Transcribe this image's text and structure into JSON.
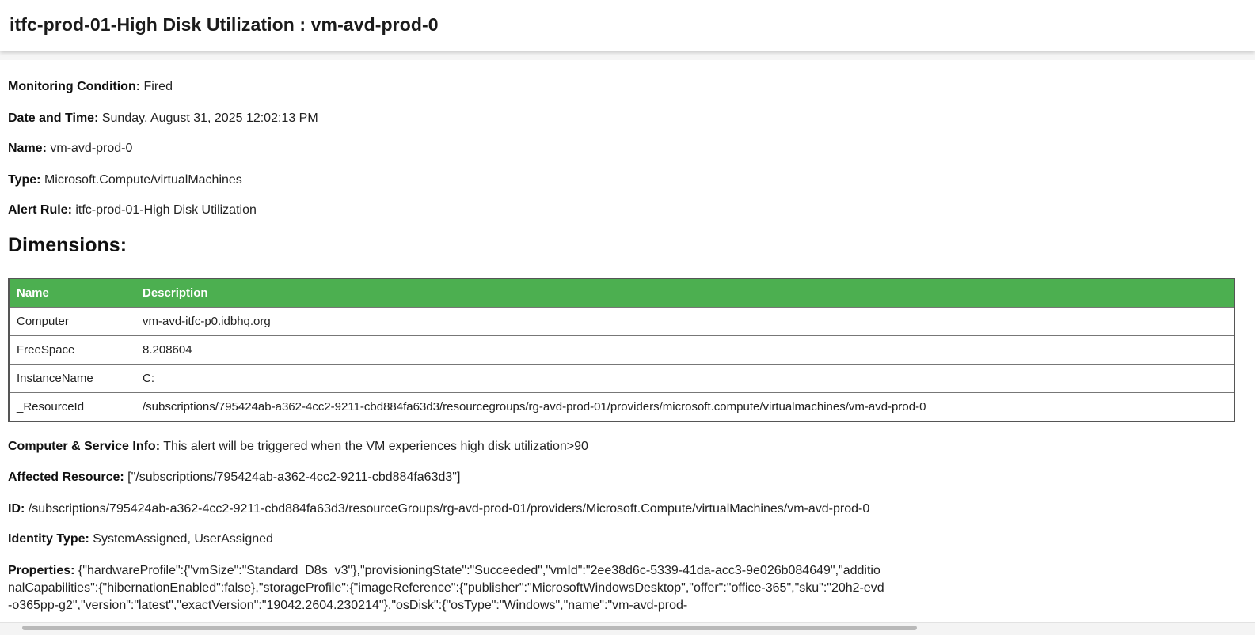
{
  "header": {
    "title": "itfc-prod-01-High Disk Utilization : vm-avd-prod-0"
  },
  "fields": {
    "monitoring_condition": {
      "label": "Monitoring Condition:",
      "value": "Fired"
    },
    "date_time": {
      "label": "Date and Time:",
      "value": "Sunday, August 31, 2025 12:02:13 PM"
    },
    "name": {
      "label": "Name:",
      "value": "vm-avd-prod-0"
    },
    "type": {
      "label": "Type:",
      "value": "Microsoft.Compute/virtualMachines"
    },
    "alert_rule": {
      "label": "Alert Rule:",
      "value": "itfc-prod-01-High Disk Utilization"
    }
  },
  "dimensions": {
    "heading": "Dimensions:",
    "columns": [
      "Name",
      "Description"
    ],
    "rows": [
      {
        "name": "Computer",
        "description": "vm-avd-itfc-p0.idbhq.org"
      },
      {
        "name": "FreeSpace",
        "description": "8.208604"
      },
      {
        "name": "InstanceName",
        "description": "C:"
      },
      {
        "name": "_ResourceId",
        "description": "/subscriptions/795424ab-a362-4cc2-9211-cbd884fa63d3/resourcegroups/rg-avd-prod-01/providers/microsoft.compute/virtualmachines/vm-avd-prod-0"
      }
    ]
  },
  "details": {
    "service_info": {
      "label": "Computer & Service Info:",
      "value": "This alert will be triggered when the VM experiences high disk utilization>90"
    },
    "affected_resource": {
      "label": "Affected Resource:",
      "value": "[\"/subscriptions/795424ab-a362-4cc2-9211-cbd884fa63d3\"]"
    },
    "id": {
      "label": "ID:",
      "value": "/subscriptions/795424ab-a362-4cc2-9211-cbd884fa63d3/resourceGroups/rg-avd-prod-01/providers/Microsoft.Compute/virtualMachines/vm-avd-prod-0"
    },
    "identity_type": {
      "label": "Identity Type:",
      "value": "SystemAssigned, UserAssigned"
    },
    "properties": {
      "label": "Properties:",
      "value": "{\"hardwareProfile\":{\"vmSize\":\"Standard_D8s_v3\"},\"provisioningState\":\"Succeeded\",\"vmId\":\"2ee38d6c-5339-41da-acc3-9e026b084649\",\"additionalCapabilities\":{\"hibernationEnabled\":false},\"storageProfile\":{\"imageReference\":{\"publisher\":\"MicrosoftWindowsDesktop\",\"offer\":\"office-365\",\"sku\":\"20h2-evd-o365pp-g2\",\"version\":\"latest\",\"exactVersion\":\"19042.2604.230214\"},\"osDisk\":{\"osType\":\"Windows\",\"name\":\"vm-avd-prod-"
    }
  }
}
